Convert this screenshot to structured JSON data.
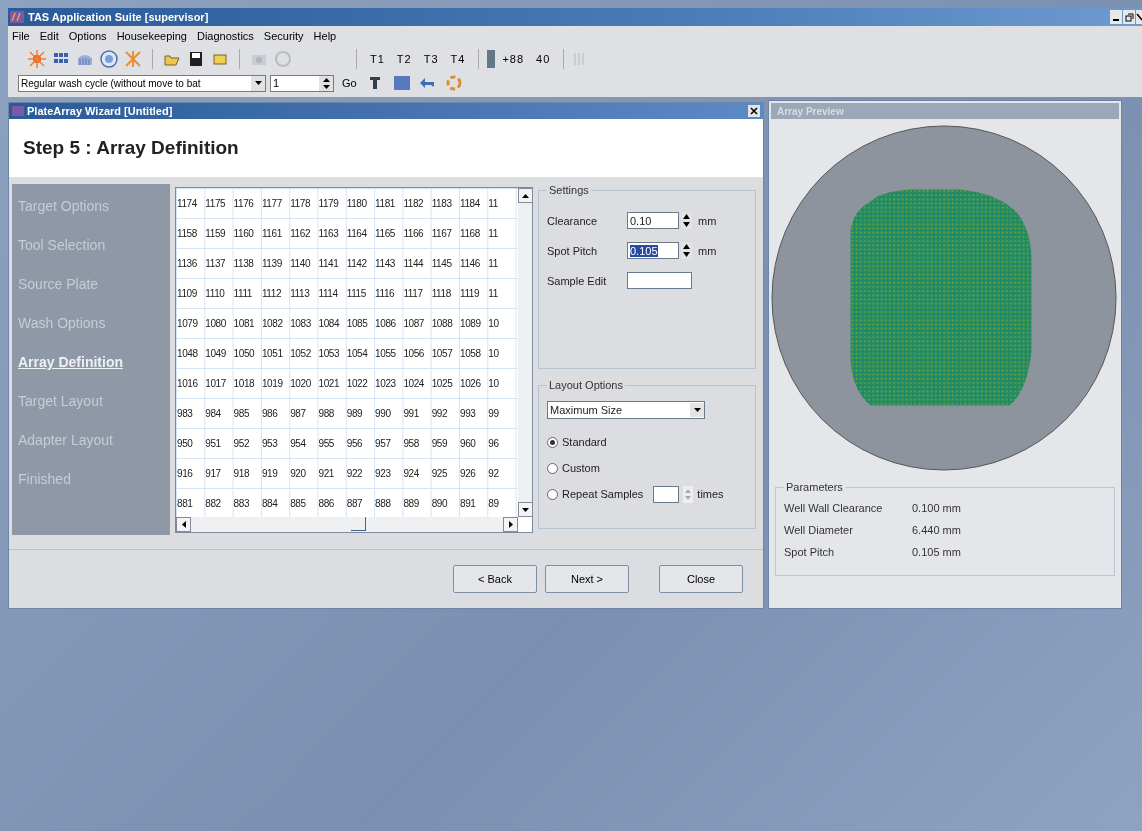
{
  "app": {
    "title": "TAS Application Suite [supervisor]",
    "menu": [
      "File",
      "Edit",
      "Options",
      "Housekeeping",
      "Diagnostics",
      "Security",
      "Help"
    ]
  },
  "toolbar": {
    "track_buttons": [
      "T1",
      "T2",
      "T3",
      "T4"
    ],
    "readings": [
      "+88",
      "40"
    ]
  },
  "command_bar": {
    "cycle": "Regular wash cycle (without move to bat",
    "count": "1",
    "go": "Go"
  },
  "wizard": {
    "title": "PlateArray Wizard [Untitled]",
    "step": "Step 5 : Array Definition",
    "steps": [
      {
        "label": "Target Options",
        "selected": false
      },
      {
        "label": "Tool Selection",
        "selected": false
      },
      {
        "label": "Source Plate",
        "selected": false
      },
      {
        "label": "Wash Options",
        "selected": false
      },
      {
        "label": "Array Definition",
        "selected": true
      },
      {
        "label": "Target Layout",
        "selected": false
      },
      {
        "label": "Adapter Layout",
        "selected": false
      },
      {
        "label": "Finished",
        "selected": false
      }
    ],
    "grid": {
      "rows": [
        [
          "1174",
          "1175",
          "1176",
          "1177",
          "1178",
          "1179",
          "1180",
          "1181",
          "1182",
          "1183",
          "1184",
          "11"
        ],
        [
          "1158",
          "1159",
          "1160",
          "1161",
          "1162",
          "1163",
          "1164",
          "1165",
          "1166",
          "1167",
          "1168",
          "11"
        ],
        [
          "1136",
          "1137",
          "1138",
          "1139",
          "1140",
          "1141",
          "1142",
          "1143",
          "1144",
          "1145",
          "1146",
          "11"
        ],
        [
          "1109",
          "1110",
          "1111",
          "1112",
          "1113",
          "1114",
          "1115",
          "1116",
          "1117",
          "1118",
          "1119",
          "11"
        ],
        [
          "1079",
          "1080",
          "1081",
          "1082",
          "1083",
          "1084",
          "1085",
          "1086",
          "1087",
          "1088",
          "1089",
          "10"
        ],
        [
          "1048",
          "1049",
          "1050",
          "1051",
          "1052",
          "1053",
          "1054",
          "1055",
          "1056",
          "1057",
          "1058",
          "10"
        ],
        [
          "1016",
          "1017",
          "1018",
          "1019",
          "1020",
          "1021",
          "1022",
          "1023",
          "1024",
          "1025",
          "1026",
          "10"
        ],
        [
          "983",
          "984",
          "985",
          "986",
          "987",
          "988",
          "989",
          "990",
          "991",
          "992",
          "993",
          "99"
        ],
        [
          "950",
          "951",
          "952",
          "953",
          "954",
          "955",
          "956",
          "957",
          "958",
          "959",
          "960",
          "96"
        ],
        [
          "916",
          "917",
          "918",
          "919",
          "920",
          "921",
          "922",
          "923",
          "924",
          "925",
          "926",
          "92"
        ],
        [
          "881",
          "882",
          "883",
          "884",
          "885",
          "886",
          "887",
          "888",
          "889",
          "890",
          "891",
          "89"
        ]
      ]
    },
    "settings": {
      "title": "Settings",
      "fields": [
        {
          "kind": "spin",
          "label": "Clearance",
          "value": "0.10",
          "unit": "mm",
          "selected": false
        },
        {
          "kind": "spin",
          "label": "Spot Pitch",
          "value": "0.105",
          "unit": "mm",
          "selected": true
        },
        {
          "kind": "text",
          "label": "Sample Edit"
        }
      ]
    },
    "layout_options": {
      "title": "Layout Options",
      "mode": "Maximum Size",
      "radios": [
        {
          "label": "Standard",
          "selected": true
        },
        {
          "label": "Custom",
          "selected": false
        },
        {
          "label": "Repeat Samples",
          "selected": false,
          "unit": "times"
        }
      ]
    },
    "buttons": [
      "< Back",
      "Next >",
      "Close"
    ]
  },
  "preview": {
    "title": "Array Preview",
    "parameters": {
      "title": "Parameters",
      "rows": [
        {
          "label": "Well Wall Clearance",
          "value": "0.100 mm"
        },
        {
          "label": "Well Diameter",
          "value": "6.440  mm"
        },
        {
          "label": "Spot Pitch",
          "value": "0.105  mm"
        }
      ]
    }
  }
}
